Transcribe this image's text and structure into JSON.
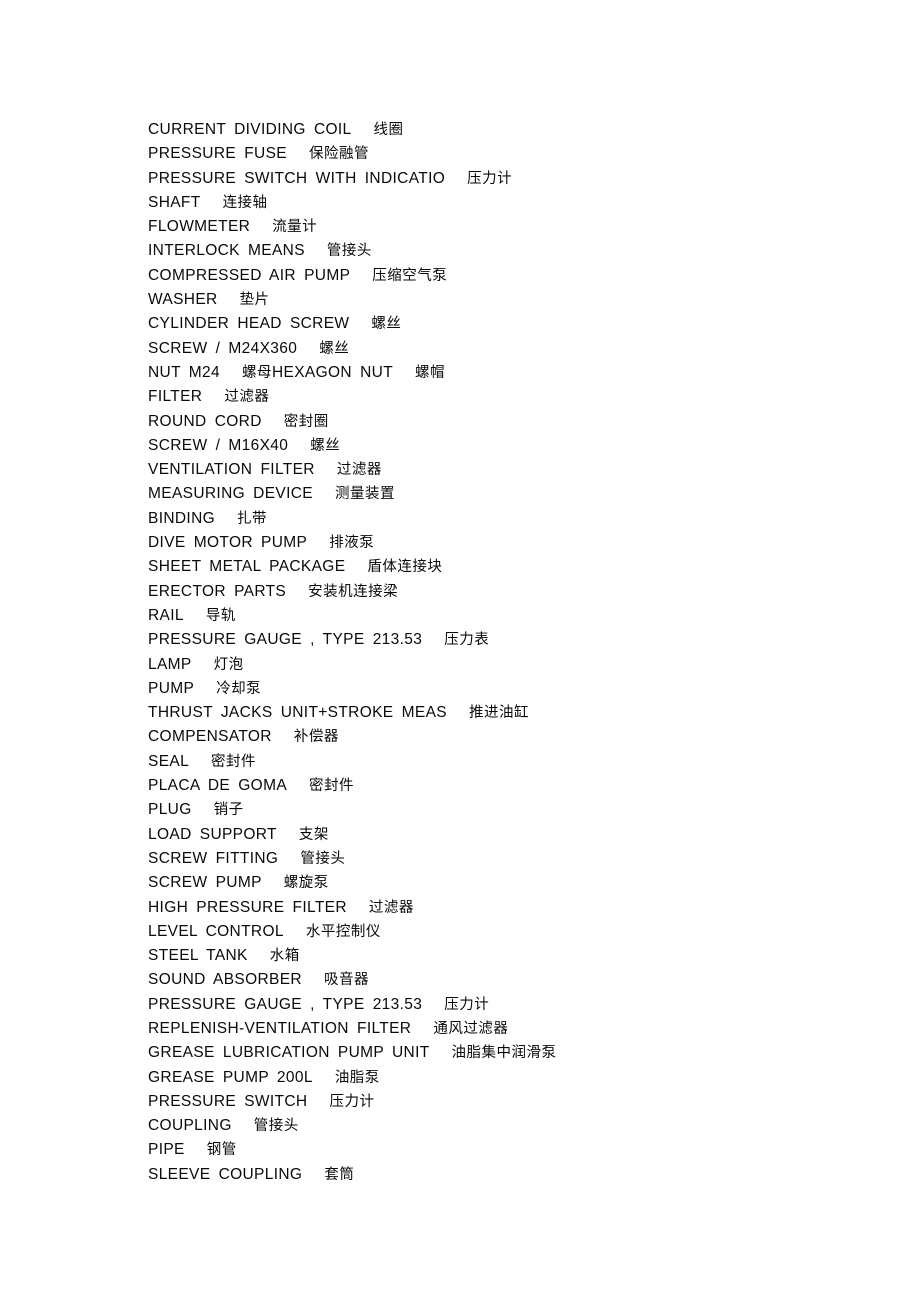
{
  "document": {
    "background_color": "#ffffff",
    "text_color": "#0a0a0a",
    "entries": [
      {
        "en": "CURRENT DIVIDING COIL",
        "zh": "线圈"
      },
      {
        "en": "PRESSURE FUSE",
        "zh": "保险融管"
      },
      {
        "en": "PRESSURE SWITCH WITH INDICATIO",
        "zh": "压力计"
      },
      {
        "en": "SHAFT",
        "zh": "连接轴"
      },
      {
        "en": "FLOWMETER",
        "zh": "流量计"
      },
      {
        "en": "INTERLOCK MEANS",
        "zh": "管接头"
      },
      {
        "en": "COMPRESSED AIR PUMP",
        "zh": "压缩空气泵"
      },
      {
        "en": "WASHER",
        "zh": "垫片"
      },
      {
        "en": "CYLINDER HEAD SCREW",
        "zh": "螺丝"
      },
      {
        "en": "SCREW / M24X360",
        "zh": "螺丝"
      },
      {
        "en": "NUT M24",
        "zh": "螺母",
        "en2": "HEXAGON NUT",
        "zh2": "螺帽"
      },
      {
        "en": "FILTER",
        "zh": "过滤器"
      },
      {
        "en": "ROUND CORD",
        "zh": "密封圈"
      },
      {
        "en": "SCREW / M16X40",
        "zh": "螺丝"
      },
      {
        "en": "VENTILATION FILTER",
        "zh": "过滤器"
      },
      {
        "en": "MEASURING DEVICE",
        "zh": "测量装置"
      },
      {
        "en": "BINDING",
        "zh": "扎带"
      },
      {
        "en": "DIVE MOTOR PUMP",
        "zh": "排液泵"
      },
      {
        "en": "SHEET METAL PACKAGE",
        "zh": "盾体连接块"
      },
      {
        "en": "ERECTOR PARTS",
        "zh": "安装机连接梁"
      },
      {
        "en": "RAIL",
        "zh": "导轨"
      },
      {
        "en": "PRESSURE GAUGE , TYPE 213.53",
        "zh": "压力表"
      },
      {
        "en": "LAMP",
        "zh": "灯泡"
      },
      {
        "en": "PUMP",
        "zh": "冷却泵"
      },
      {
        "en": "THRUST JACKS UNIT+STROKE MEAS",
        "zh": "推进油缸"
      },
      {
        "en": "COMPENSATOR",
        "zh": "补偿器"
      },
      {
        "en": "SEAL",
        "zh": "密封件"
      },
      {
        "en": "PLACA DE GOMA",
        "zh": "密封件"
      },
      {
        "en": "PLUG",
        "zh": "销子"
      },
      {
        "en": "LOAD SUPPORT",
        "zh": "支架"
      },
      {
        "en": "SCREW FITTING",
        "zh": "管接头"
      },
      {
        "en": "SCREW PUMP",
        "zh": "螺旋泵"
      },
      {
        "en": "HIGH PRESSURE FILTER",
        "zh": "过滤器"
      },
      {
        "en": "LEVEL CONTROL",
        "zh": "水平控制仪"
      },
      {
        "en": "STEEL TANK",
        "zh": "水箱"
      },
      {
        "en": "SOUND ABSORBER",
        "zh": "吸音器"
      },
      {
        "en": "PRESSURE GAUGE , TYPE 213.53",
        "zh": "压力计"
      },
      {
        "en": "REPLENISH-VENTILATION FILTER",
        "zh": "通风过滤器"
      },
      {
        "en": "GREASE LUBRICATION PUMP UNIT",
        "zh": "油脂集中润滑泵"
      },
      {
        "en": "GREASE PUMP 200L",
        "zh": "油脂泵"
      },
      {
        "en": "PRESSURE SWITCH",
        "zh": "压力计"
      },
      {
        "en": "COUPLING",
        "zh": "管接头"
      },
      {
        "en": "PIPE",
        "zh": "钢管"
      },
      {
        "en": "SLEEVE COUPLING",
        "zh": "套筒"
      }
    ]
  }
}
